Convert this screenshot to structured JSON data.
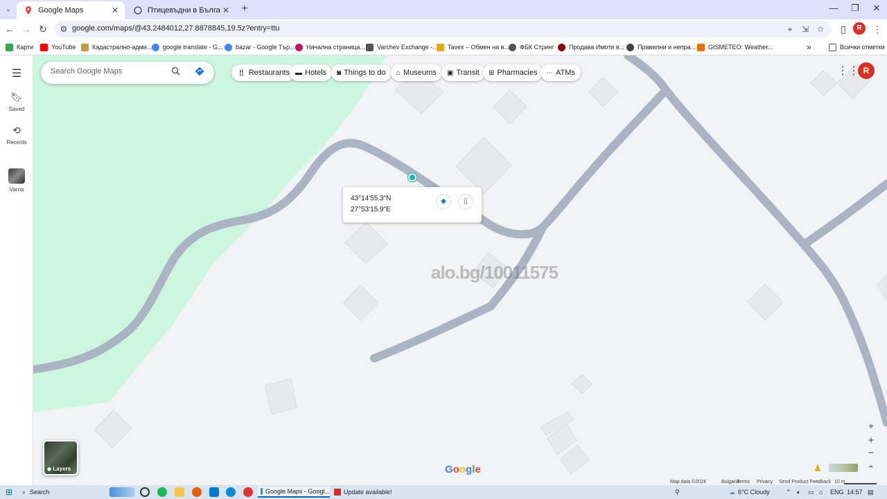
{
  "browser": {
    "tabs": [
      {
        "title": "Google Maps",
        "active": true
      },
      {
        "title": "Птицевъдни в България. Коко",
        "active": false
      }
    ],
    "new_tab": "+",
    "url": "google.com/maps/@43.2484012,27.8878845,19.5z?entry=ttu",
    "bookmarks": [
      {
        "label": "Карти",
        "color": "#34a853"
      },
      {
        "label": "YouTube",
        "color": "#ff0000"
      },
      {
        "label": "Кадастрално-адми...",
        "color": "#c59c3a"
      },
      {
        "label": "google translate - G...",
        "color": "#4285f4"
      },
      {
        "label": "bazar - Google Тър...",
        "color": "#4285f4"
      },
      {
        "label": "Начална страница...",
        "color": "#c2185b"
      },
      {
        "label": "Varchev Exchange -...",
        "color": "#555555"
      },
      {
        "label": "Tavex – Обмен на в...",
        "color": "#e6a817"
      },
      {
        "label": "ФБК Стринг",
        "color": "#555555"
      },
      {
        "label": "Продава Имоти в...",
        "color": "#8b0000"
      },
      {
        "label": "Правилни и непра...",
        "color": "#444444"
      },
      {
        "label": "GISMETEO: Weather...",
        "color": "#e8710a"
      }
    ],
    "bookmarks_more": "»",
    "all_bookmarks": "Всички отметки",
    "profile_initial": "R"
  },
  "leftrail": {
    "items": [
      {
        "label": "Saved"
      },
      {
        "label": "Recents"
      },
      {
        "label": "Varna"
      }
    ]
  },
  "search": {
    "placeholder": "Search Google Maps"
  },
  "chips": [
    {
      "label": "Restaurants",
      "icon": "fork-knife-icon"
    },
    {
      "label": "Hotels",
      "icon": "bed-icon"
    },
    {
      "label": "Things to do",
      "icon": "camera-icon"
    },
    {
      "label": "Museums",
      "icon": "museum-icon"
    },
    {
      "label": "Transit",
      "icon": "train-icon"
    },
    {
      "label": "Pharmacies",
      "icon": "pharmacy-icon"
    },
    {
      "label": "ATMs",
      "icon": "atm-icon"
    }
  ],
  "account_initial": "R",
  "popup": {
    "lat": "43°14'55.3\"N",
    "lng": "27°53'15.9\"E"
  },
  "watermark": "alo.bg/10011575",
  "layers_label": "Layers",
  "google_logo": "Google",
  "bottom": {
    "map_data": "Map data ©2024",
    "country": "Bulgaria",
    "terms": "Terms",
    "privacy": "Privacy",
    "feedback": "Send Product Feedback",
    "scale": "10 m"
  },
  "colors": {
    "road": "#aab4c3",
    "park": "#cdf6df",
    "building": "#e8e9eb",
    "map_bg": "#f2f3f4",
    "accent": "#1a73e8"
  },
  "taskbar": {
    "search": "Search",
    "app1": "Google Maps - Googl...",
    "app2": "Update available!",
    "weather": "6°C  Cloudy",
    "lang": "ENG",
    "time": "14:57"
  }
}
